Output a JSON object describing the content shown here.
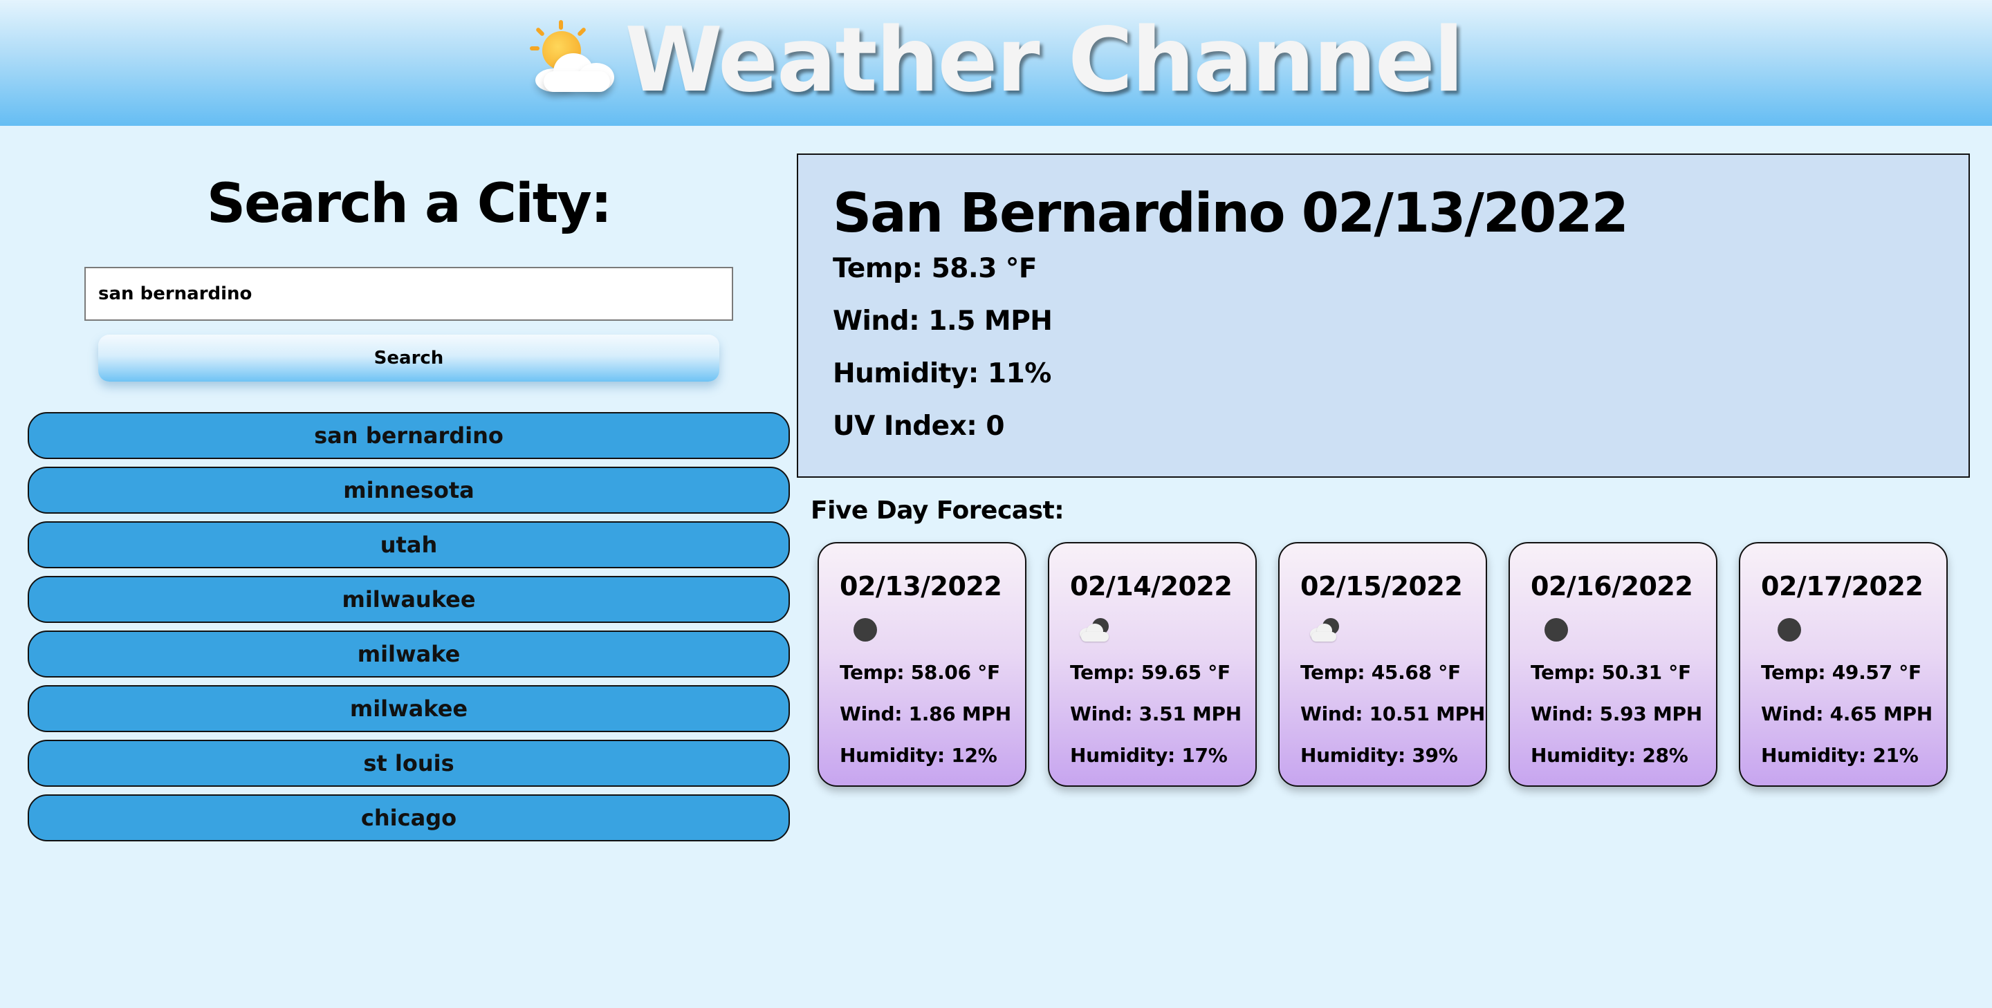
{
  "header": {
    "title": "Weather Channel",
    "logo_icon": "sun-behind-cloud-icon"
  },
  "search": {
    "heading": "Search a City:",
    "input_value": "san bernardino",
    "button_label": "Search"
  },
  "history": [
    "san bernardino",
    "minnesota",
    "utah",
    "milwaukee",
    "milwake",
    "milwakee",
    "st louis",
    "chicago"
  ],
  "current": {
    "title": "San Bernardino 02/13/2022",
    "temp": "Temp: 58.3 °F",
    "wind": "Wind: 1.5 MPH",
    "humidity": "Humidity: 11%",
    "uv": "UV Index: 0"
  },
  "forecast": {
    "heading": "Five Day Forecast:",
    "days": [
      {
        "date": "02/13/2022",
        "icon": "clear-night-icon",
        "temp": "Temp: 58.06 °F",
        "wind": "Wind: 1.86 MPH",
        "humidity": "Humidity: 12%"
      },
      {
        "date": "02/14/2022",
        "icon": "partly-cloudy-night-icon",
        "temp": "Temp: 59.65 °F",
        "wind": "Wind: 3.51 MPH",
        "humidity": "Humidity: 17%"
      },
      {
        "date": "02/15/2022",
        "icon": "partly-cloudy-night-icon",
        "temp": "Temp: 45.68 °F",
        "wind": "Wind: 10.51 MPH",
        "humidity": "Humidity: 39%"
      },
      {
        "date": "02/16/2022",
        "icon": "clear-night-icon",
        "temp": "Temp: 50.31 °F",
        "wind": "Wind: 5.93 MPH",
        "humidity": "Humidity: 28%"
      },
      {
        "date": "02/17/2022",
        "icon": "clear-night-icon",
        "temp": "Temp: 49.57 °F",
        "wind": "Wind: 4.65 MPH",
        "humidity": "Humidity: 21%"
      }
    ]
  },
  "colors": {
    "page_bg": "#e1f3fd",
    "history_button": "#39a3e1",
    "current_card_bg": "#cde0f4",
    "forecast_card_bottom": "#c7a5ef"
  }
}
